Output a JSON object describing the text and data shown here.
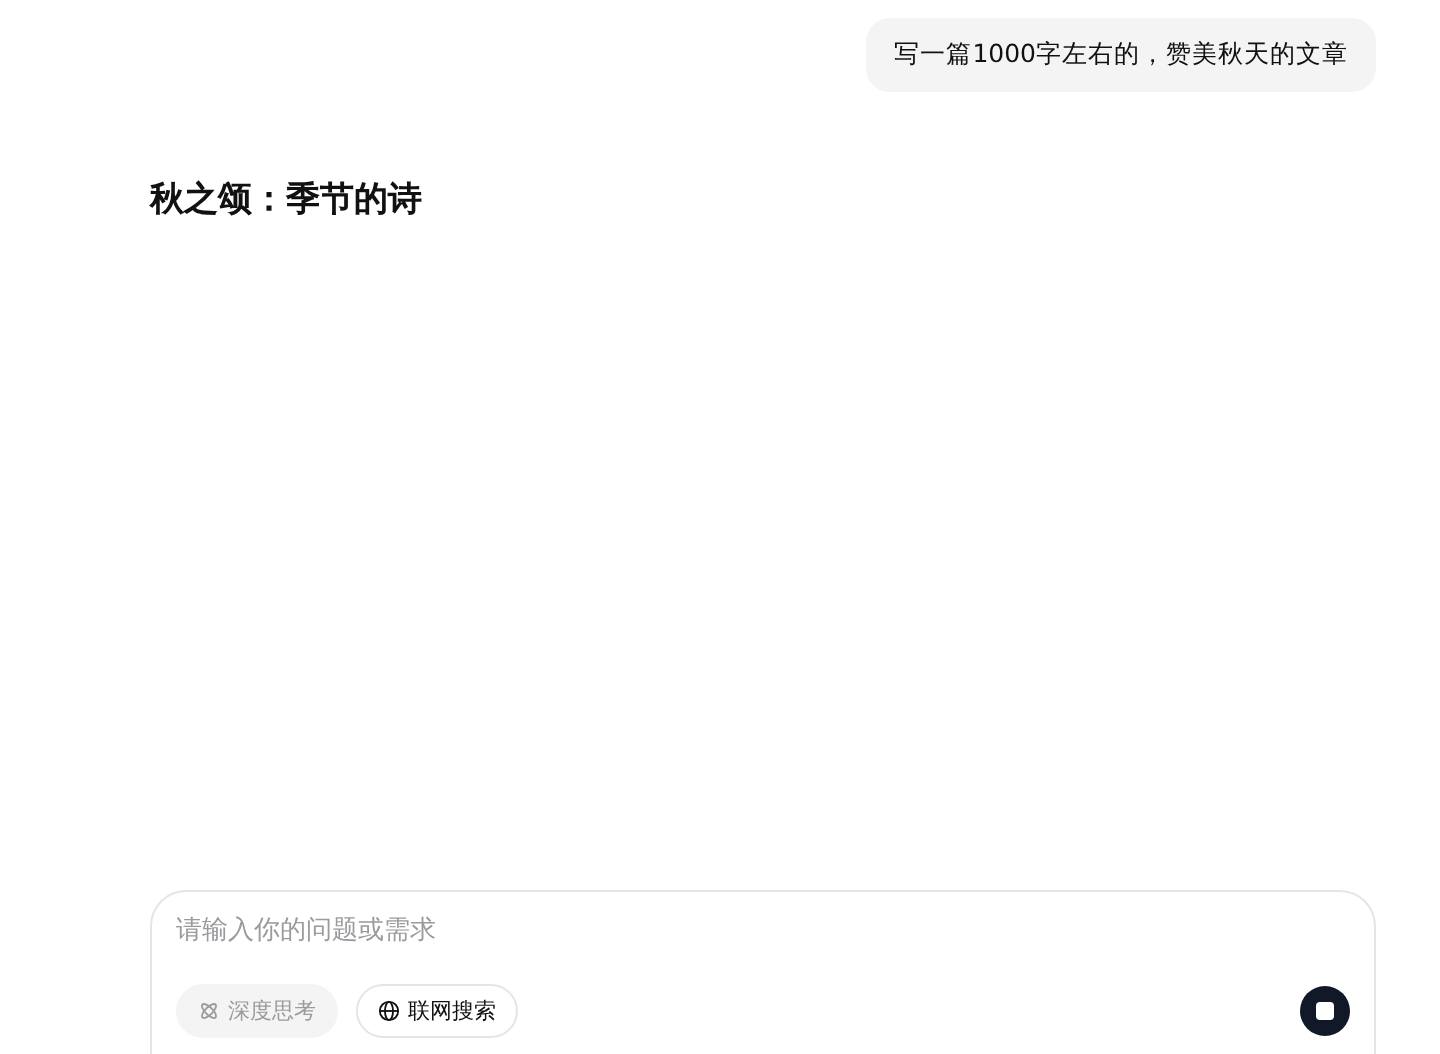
{
  "user_message": "写一篇1000字左右的，赞美秋天的文章",
  "reply": {
    "heading": "秋之颂：季节的诗"
  },
  "composer": {
    "placeholder": "请输入你的问题或需求",
    "toggles": [
      {
        "label": "深度思考",
        "kind": "think",
        "disabled": true
      },
      {
        "label": "联网搜索",
        "kind": "web",
        "disabled": false
      }
    ]
  }
}
